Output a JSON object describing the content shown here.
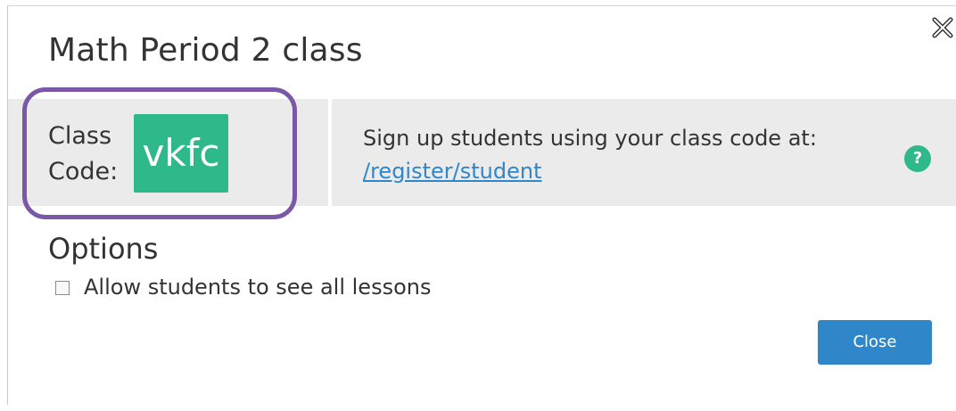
{
  "dialog": {
    "title": "Math Period 2 class",
    "close_icon": "close-x-icon"
  },
  "class_code": {
    "label_line1": "Class",
    "label_line2": "Code:",
    "code": "vkfc",
    "highlight_color": "#7b58a6",
    "chip_color": "#2fb88a"
  },
  "signup": {
    "text": "Sign up students using your class code at:",
    "link": "/register/student",
    "help_icon": "help-question-icon",
    "help_glyph": "?"
  },
  "options": {
    "heading": "Options",
    "checkbox_label": "Allow students to see all lessons",
    "checkbox_checked": false
  },
  "footer": {
    "close_label": "Close",
    "button_color": "#2f86c8"
  }
}
